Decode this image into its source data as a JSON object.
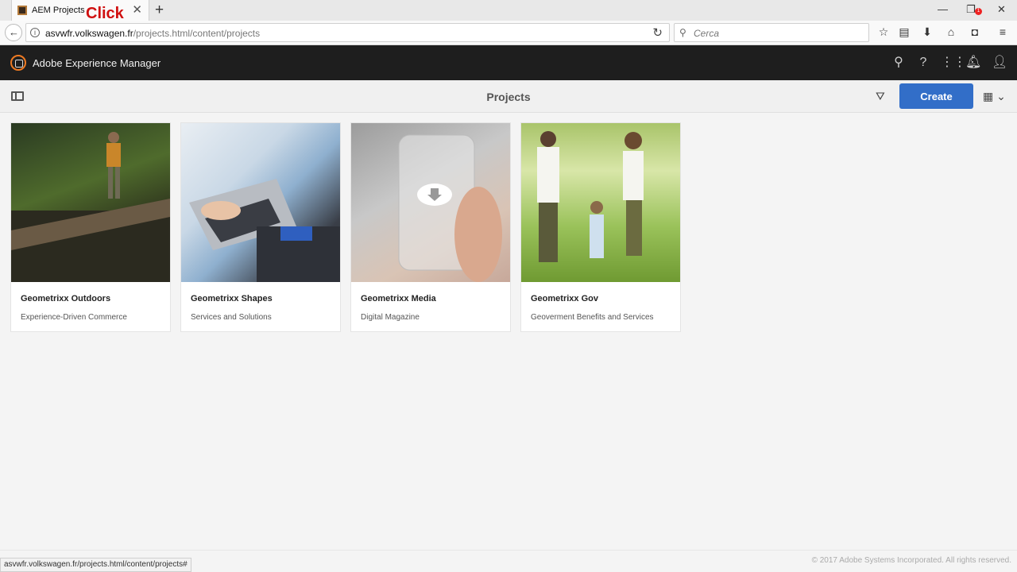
{
  "browser": {
    "tab_title": "AEM Projects",
    "url_host": "asvwfr.volkswagen.fr",
    "url_path": "/projects.html/content/projects",
    "search_placeholder": "Cerca",
    "annotation": "Click"
  },
  "header": {
    "title": "Adobe Experience Manager",
    "notification_count": "1"
  },
  "actionbar": {
    "title": "Projects",
    "create_label": "Create"
  },
  "cards": [
    {
      "title": "Geometrixx Outdoors",
      "subtitle": "Experience-Driven Commerce"
    },
    {
      "title": "Geometrixx Shapes",
      "subtitle": "Services and Solutions"
    },
    {
      "title": "Geometrixx Media",
      "subtitle": "Digital Magazine"
    },
    {
      "title": "Geometrixx Gov",
      "subtitle": "Geoverment Benefits and Services"
    }
  ],
  "status_url": "asvwfr.volkswagen.fr/projects.html/content/projects#",
  "footer": "© 2017 Adobe Systems Incorporated. All rights reserved."
}
